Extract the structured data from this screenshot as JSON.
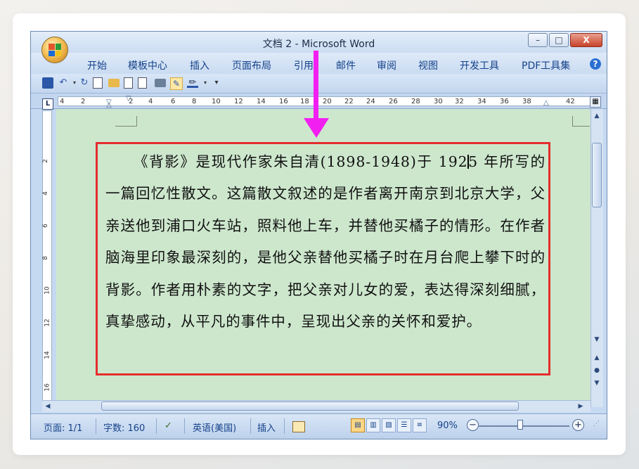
{
  "window": {
    "title": "文档 2 - Microsoft Word",
    "minimize_glyph": "–",
    "maximize_glyph": "□",
    "close_glyph": "X"
  },
  "ribbon_tabs": [
    "开始",
    "模板中心",
    "插入",
    "页面布局",
    "引用",
    "邮件",
    "审阅",
    "视图",
    "开发工具",
    "PDF工具集"
  ],
  "help_glyph": "?",
  "ruler": {
    "tab_selector": "L",
    "numbers": [
      "4",
      "2",
      "2",
      "4",
      "6",
      "8",
      "10",
      "12",
      "14",
      "16",
      "18",
      "20",
      "22",
      "24",
      "26",
      "28",
      "30",
      "32",
      "34",
      "36",
      "38",
      "42"
    ],
    "v_numbers": [
      "2",
      "4",
      "6",
      "8",
      "10",
      "12",
      "14",
      "16"
    ]
  },
  "document": {
    "text_before_caret": "《背影》是现代作家朱自清(1898-1948)于 192",
    "text_after_caret": "5  年所写的一篇回忆性散文。这篇散文叙述的是作者离开南京到北京大学，父亲送他到浦口火车站，照料他上车，并替他买橘子的情形。在作者脑海里印象最深刻的，是他父亲替他买橘子时在月台爬上攀下时的背影。作者用朴素的文字，把父亲对儿女的爱，表达得深刻细腻，真挚感动，从平凡的事件中，呈现出父亲的关怀和爱护。"
  },
  "statusbar": {
    "page": "页面: 1/1",
    "words": "字数: 160",
    "language": "英语(美国)",
    "insert_mode": "插入",
    "zoom": "90%",
    "zoom_out": "−",
    "zoom_in": "+"
  },
  "colors": {
    "annotation_arrow": "#f21ff1",
    "highlight_box": "#e52d2d",
    "page_background": "#cde7cd"
  }
}
